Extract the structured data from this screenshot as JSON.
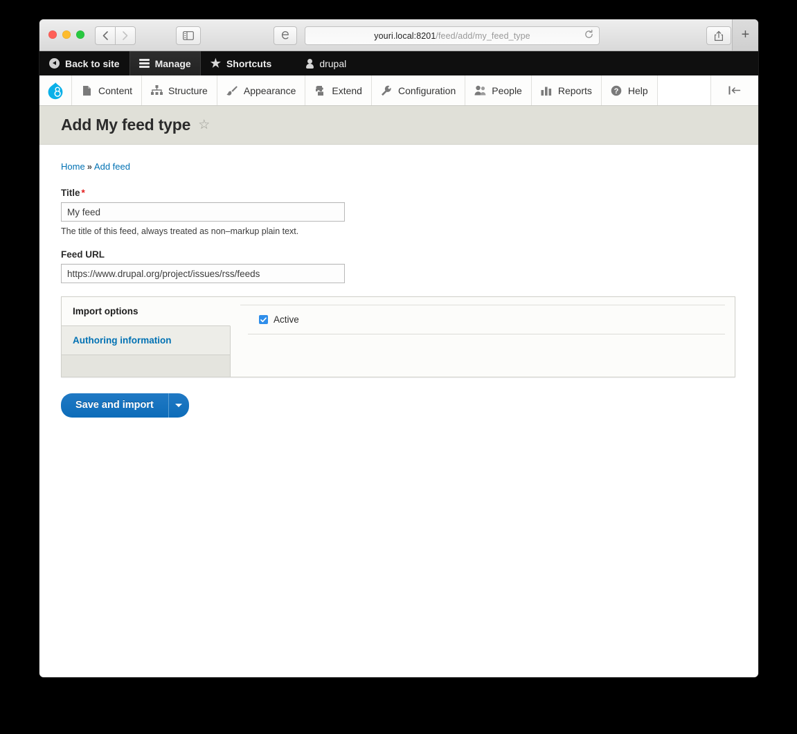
{
  "browser": {
    "url_host": "youri.local:8201",
    "url_path": "/feed/add/my_feed_type",
    "reload_icon": "reload-icon",
    "back_icon": "chevron-left-icon",
    "forward_icon": "chevron-right-icon",
    "sidebar_icon": "sidebar-toggle-icon",
    "reader_icon": "reader-icon",
    "share_icon": "share-icon",
    "tabs_icon": "tab-overview-icon",
    "newtab_label": "+",
    "lights": [
      "close",
      "minimize",
      "zoom"
    ]
  },
  "admin_toolbar": {
    "items": [
      {
        "label": "Back to site",
        "icon": "back-circle-icon",
        "active": false
      },
      {
        "label": "Manage",
        "icon": "hamburger-icon",
        "active": true
      },
      {
        "label": "Shortcuts",
        "icon": "star-icon",
        "active": false
      },
      {
        "label": "drupal",
        "icon": "person-icon",
        "active": false
      }
    ]
  },
  "menu_bar": {
    "logo": "drupal-logo-icon",
    "items": [
      {
        "label": "Content",
        "icon": "file-icon"
      },
      {
        "label": "Structure",
        "icon": "structure-icon"
      },
      {
        "label": "Appearance",
        "icon": "paintbrush-icon"
      },
      {
        "label": "Extend",
        "icon": "puzzle-icon"
      },
      {
        "label": "Configuration",
        "icon": "wrench-icon"
      },
      {
        "label": "People",
        "icon": "people-icon"
      },
      {
        "label": "Reports",
        "icon": "bar-chart-icon"
      },
      {
        "label": "Help",
        "icon": "question-circle-icon"
      }
    ],
    "collapse_icon": "collapse-left-icon"
  },
  "page": {
    "title": "Add My feed type",
    "bookmark_icon": "star-outline-icon",
    "breadcrumb": {
      "home": "Home",
      "separator": "»",
      "current": "Add feed"
    }
  },
  "form": {
    "title_field": {
      "label": "Title",
      "required_marker": "*",
      "value": "My feed",
      "placeholder": "",
      "description": "The title of this feed, always treated as non–markup plain text."
    },
    "feed_url_field": {
      "label": "Feed URL",
      "value": "https://www.drupal.org/project/issues/rss/feeds",
      "placeholder": ""
    },
    "vertical_tabs": [
      {
        "label": "Import options",
        "selected": true
      },
      {
        "label": "Authoring information",
        "selected": false
      }
    ],
    "import_options": {
      "active_checkbox": {
        "label": "Active",
        "checked": true
      }
    },
    "submit": {
      "label": "Save and import",
      "dropdown_icon": "caret-down-icon"
    }
  },
  "colors": {
    "accent_blue": "#0d6cb9",
    "link_blue": "#0071b3",
    "required_red": "#e31d1d",
    "header_band": "#e0e0d8",
    "drupal_cyan": "#0ab0e8",
    "checkbox_blue": "#2f8eea"
  }
}
